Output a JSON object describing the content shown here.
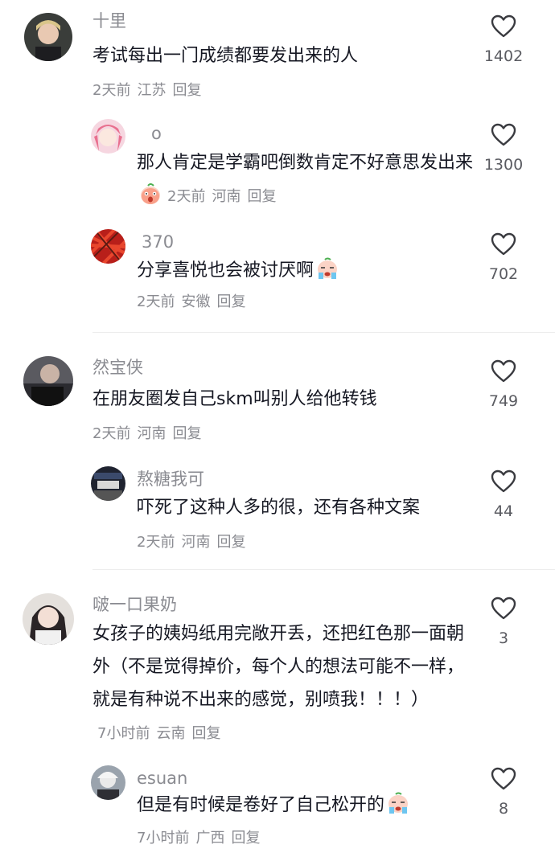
{
  "comments": [
    {
      "username": "十里",
      "text": "考试每出一门成绩都要发出来的人",
      "time": "2天前",
      "location": "江苏",
      "reply": "回复",
      "likes": "1402",
      "replies": [
        {
          "username": "o",
          "text": "那人肯定是学霸吧倒数肯定不好意思发出来",
          "emoji": "scared-face-emoji",
          "time": "2天前",
          "location": "河南",
          "reply": "回复",
          "likes": "1300"
        },
        {
          "username": "370",
          "text": "分享喜悦也会被讨厌啊",
          "emoji": "crying-face-emoji",
          "time": "2天前",
          "location": "安徽",
          "reply": "回复",
          "likes": "702"
        }
      ]
    },
    {
      "username": "然宝侠",
      "text": "在朋友圈发自己skm叫别人给他转钱",
      "time": "2天前",
      "location": "河南",
      "reply": "回复",
      "likes": "749",
      "replies": [
        {
          "username": "熬糖我可",
          "text": "吓死了这种人多的很，还有各种文案",
          "time": "2天前",
          "location": "河南",
          "reply": "回复",
          "likes": "44"
        }
      ]
    },
    {
      "username": "啵一口果奶",
      "text": "女孩子的姨妈纸用完敞开丢，还把红色那一面朝外（不是觉得掉价，每个人的想法可能不一样，就是有种说不出来的感觉，别喷我！！！）",
      "time": "7小时前",
      "location": "云南",
      "reply": "回复",
      "likes": "3",
      "replies": [
        {
          "username": "esuan",
          "text": "但是有时候是卷好了自己松开的",
          "emoji": "crying-face-emoji",
          "time": "7小时前",
          "location": "广西",
          "reply": "回复",
          "likes": "8"
        }
      ]
    }
  ],
  "icons": {
    "like": "heart-outline-icon"
  },
  "colors": {
    "text": "#161823",
    "secondary": "#8a8b91",
    "divider": "#ededed"
  }
}
